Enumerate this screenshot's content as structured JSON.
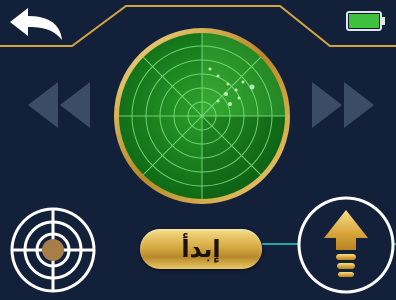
{
  "start_button": {
    "label": "إبدأ"
  },
  "battery": {
    "level": 1.0,
    "color": "#3fc13f"
  },
  "colors": {
    "background": "#13203a",
    "accent_gold": "#d4a53e",
    "radar_green": "#1f8a1f",
    "radar_line": "#7fe07f",
    "arrow_inactive": "#3b4d66",
    "ground_line": "#1fa7b0"
  },
  "icons": {
    "back": "back-arrow-icon",
    "battery": "battery-icon",
    "left": "double-chevron-left-icon",
    "right": "double-chevron-right-icon",
    "target": "crosshair-target-icon",
    "up": "up-arrow-icon"
  }
}
